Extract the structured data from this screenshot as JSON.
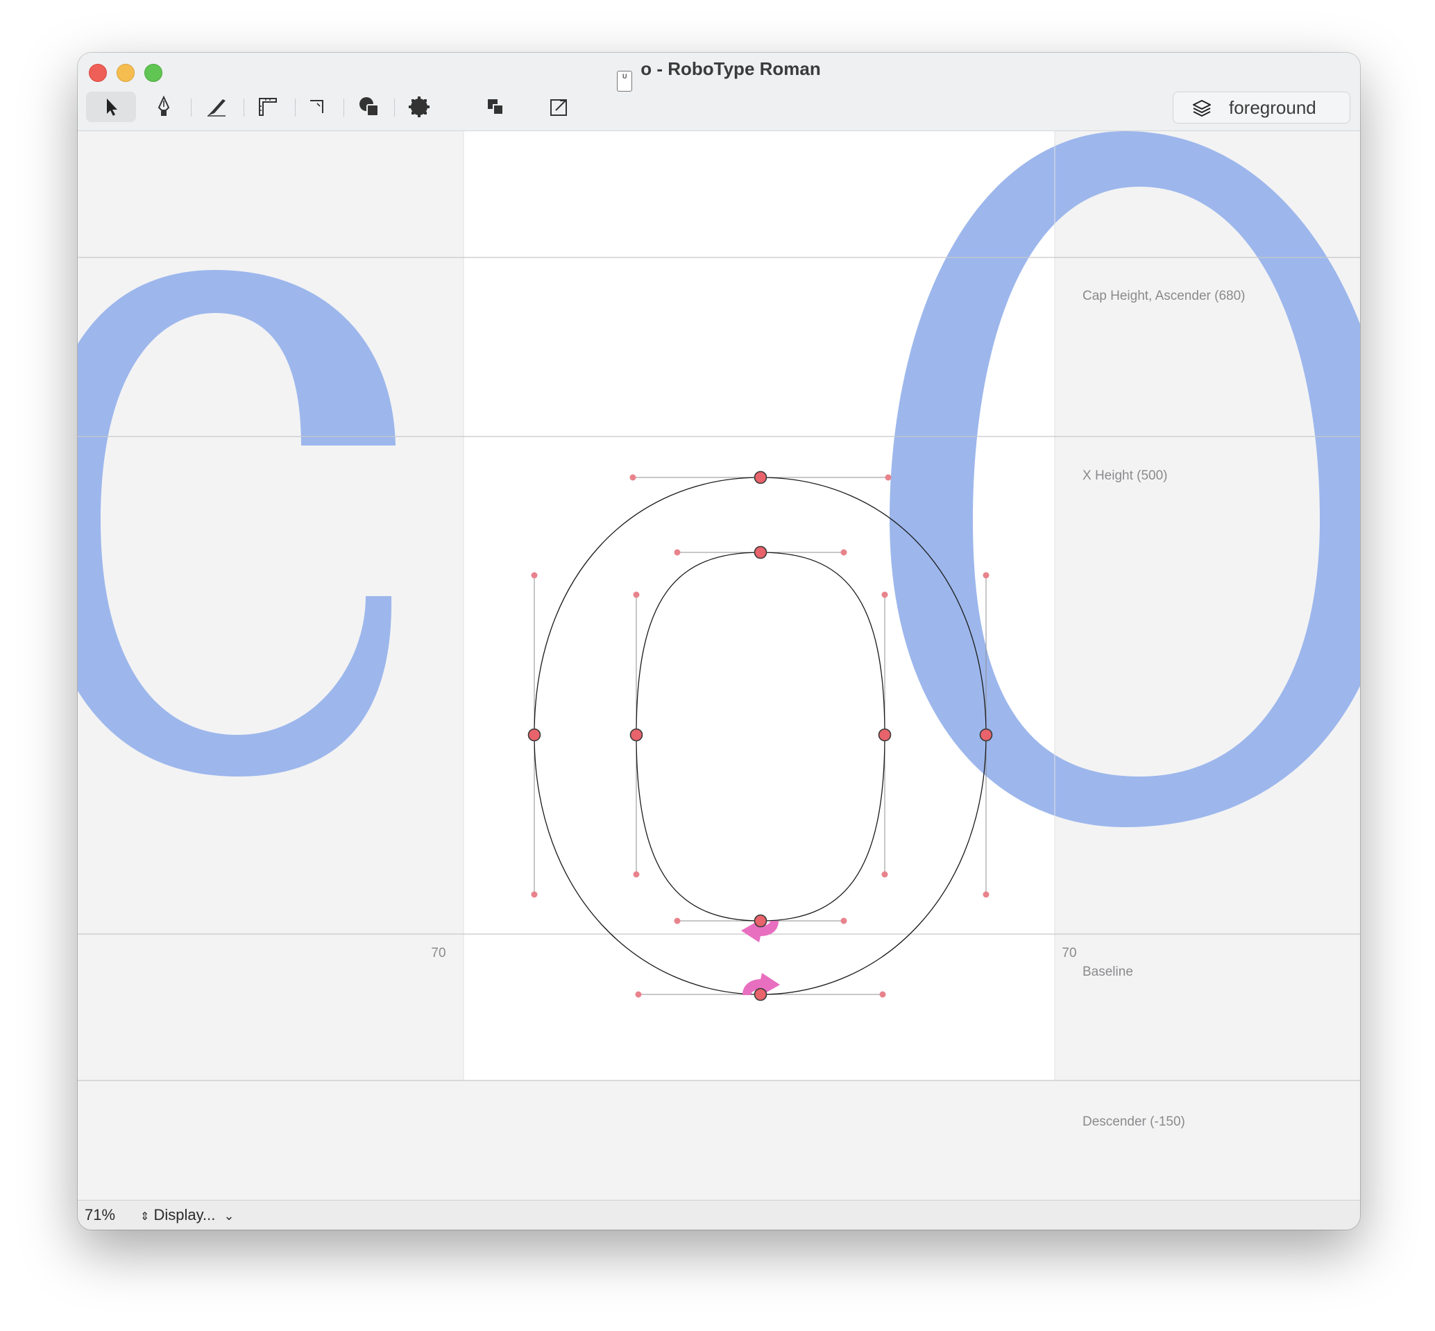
{
  "window": {
    "title": "o - RoboType Roman",
    "doc_icon_label": "U"
  },
  "toolbar": {
    "tools": [
      {
        "name": "editing-tool",
        "icon": "arrow-pointer-icon",
        "active": true
      },
      {
        "name": "bezier-tool",
        "icon": "pen-nib-icon",
        "active": false
      },
      {
        "name": "slice-tool",
        "icon": "knife-icon",
        "active": false
      },
      {
        "name": "measurement-tool",
        "icon": "ruler-icon",
        "active": false
      },
      {
        "name": "corner-tool",
        "icon": "corner-icon",
        "active": false
      },
      {
        "name": "shapes-tool",
        "icon": "shapes-icon",
        "active": false
      },
      {
        "name": "contour-tool",
        "icon": "gear-blob-icon",
        "active": false
      },
      {
        "name": "overlap-tool",
        "icon": "overlap-squares-icon",
        "active": false
      },
      {
        "name": "transform-tool",
        "icon": "scale-box-icon",
        "active": false
      }
    ],
    "layer_label": "foreground"
  },
  "guides": {
    "cap_height": "Cap Height, Ascender (680)",
    "x_height": "X Height (500)",
    "baseline": "Baseline",
    "descender": "Descender (-150)"
  },
  "sidebearings": {
    "left": "70",
    "right": "70"
  },
  "glyphs": {
    "previous": "c",
    "current": "o",
    "next": "O"
  },
  "colors": {
    "neighbor_glyph": "#9db7ec",
    "point_fill": "#e8636b",
    "handle": "#e8838c",
    "start_arrow": "#e86fc0",
    "margin_bg": "#f3f3f4",
    "glyph_bg": "#ffffff",
    "guide_line": "#c8c8ca"
  },
  "status": {
    "zoom": "71%",
    "display_label": "Display..."
  }
}
